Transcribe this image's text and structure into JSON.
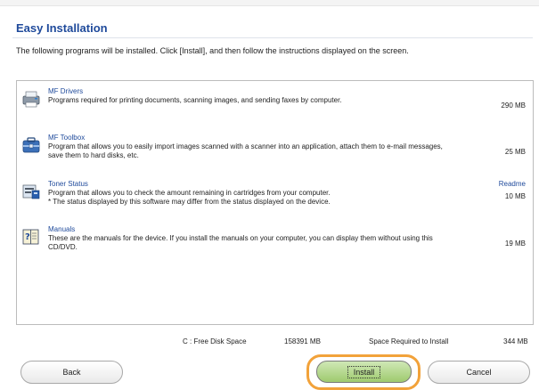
{
  "header": {
    "title": "Easy Installation",
    "instruction": "The following programs will be installed. Click [Install], and then follow the instructions displayed on the screen."
  },
  "programs": [
    {
      "icon": "printer-icon",
      "name": "MF Drivers",
      "description": "Programs required for printing documents, scanning images, and sending faxes by computer.",
      "size": "290 MB"
    },
    {
      "icon": "toolbox-icon",
      "name": "MF Toolbox",
      "description": "Program that allows you to easily import images scanned with a scanner into an application, attach them to e-mail messages, save them to hard disks, etc.",
      "size": "25 MB"
    },
    {
      "icon": "toner-icon",
      "name": "Toner Status",
      "description": "Program that allows you to check the amount remaining in cartridges from your computer.\n* The status displayed by this software may differ from the status displayed on the device.",
      "size": "10 MB",
      "link": "Readme"
    },
    {
      "icon": "manual-book-icon",
      "name": "Manuals",
      "description": "These are the manuals for the device. If you install the manuals on your computer, you can display them without using this CD/DVD.",
      "size": "19 MB"
    }
  ],
  "status": {
    "drive_label": "C : Free Disk Space",
    "free_space": "158391 MB",
    "required_label": "Space Required to Install",
    "required_value": "344 MB"
  },
  "buttons": {
    "back": "Back",
    "install": "Install",
    "cancel": "Cancel"
  },
  "colors": {
    "accent": "#1f4a9b",
    "install_highlight": "#f2a23a",
    "install_button": "#9fca6e"
  }
}
